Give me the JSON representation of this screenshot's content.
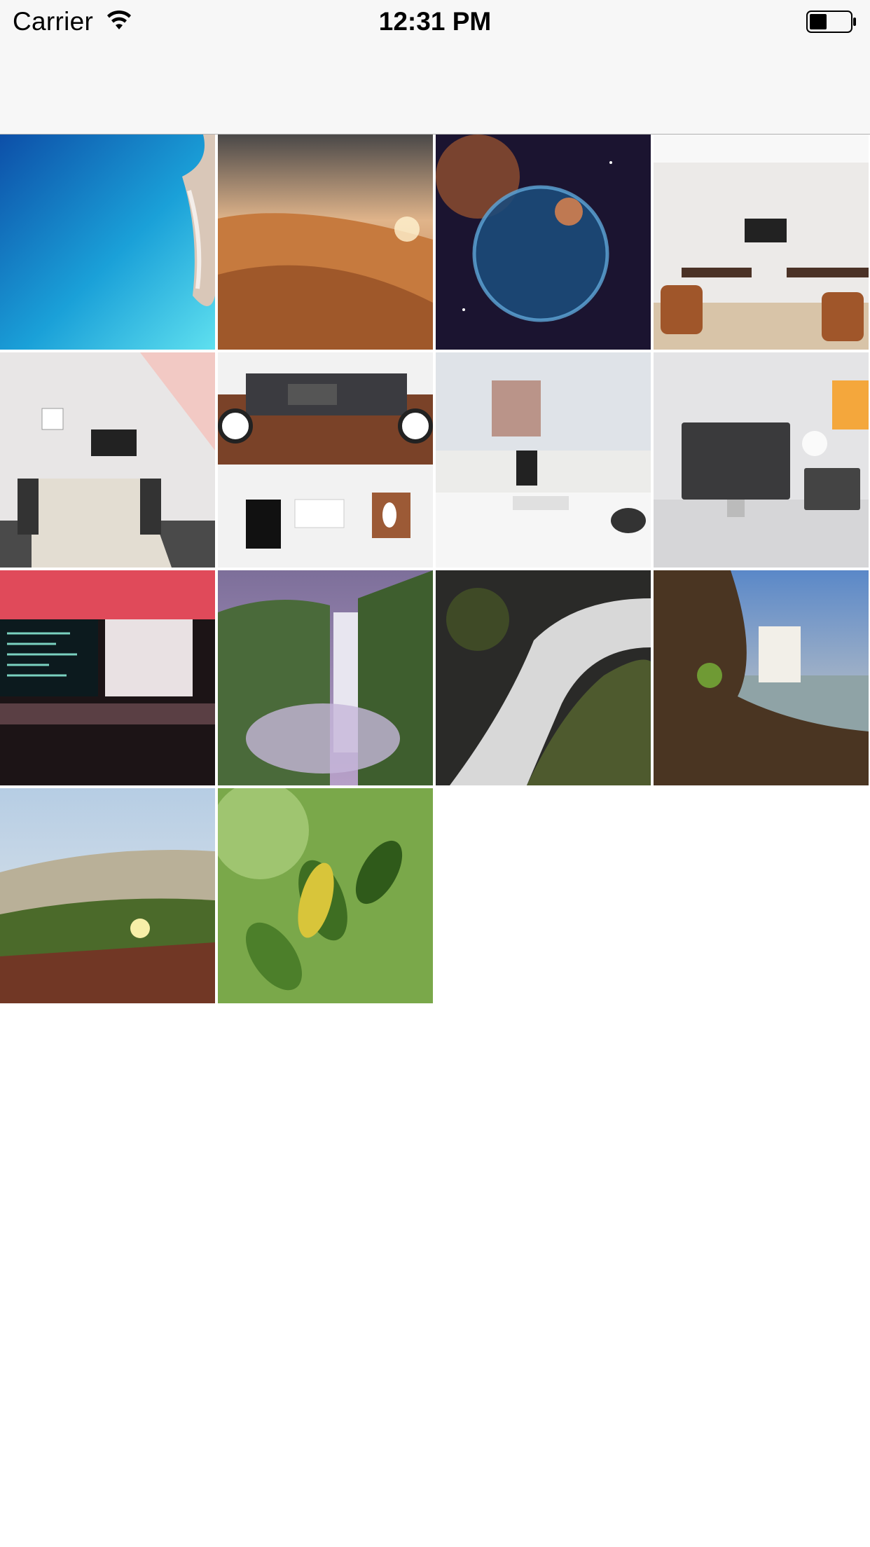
{
  "status_bar": {
    "carrier": "Carrier",
    "time": "12:31 PM",
    "battery_level": 0.4
  },
  "photos": [
    {
      "icon": "ocean-coast-photo"
    },
    {
      "icon": "desert-dune-photo"
    },
    {
      "icon": "bubble-nebula-photo"
    },
    {
      "icon": "office-meeting-room-photo"
    },
    {
      "icon": "conference-room-photo"
    },
    {
      "icon": "desk-flatlay-photo"
    },
    {
      "icon": "computer-monitor-desk-photo"
    },
    {
      "icon": "imac-desk-photo"
    },
    {
      "icon": "dual-monitor-code-photo"
    },
    {
      "icon": "waterfall-cliff-photo"
    },
    {
      "icon": "waterfall-rocks-photo"
    },
    {
      "icon": "waterfall-mossy-rocks-photo"
    },
    {
      "icon": "beach-flower-photo"
    },
    {
      "icon": "green-leaves-photo"
    }
  ],
  "colors": {
    "bar_background": "#f7f7f7",
    "separator": "#b2b2b2"
  }
}
